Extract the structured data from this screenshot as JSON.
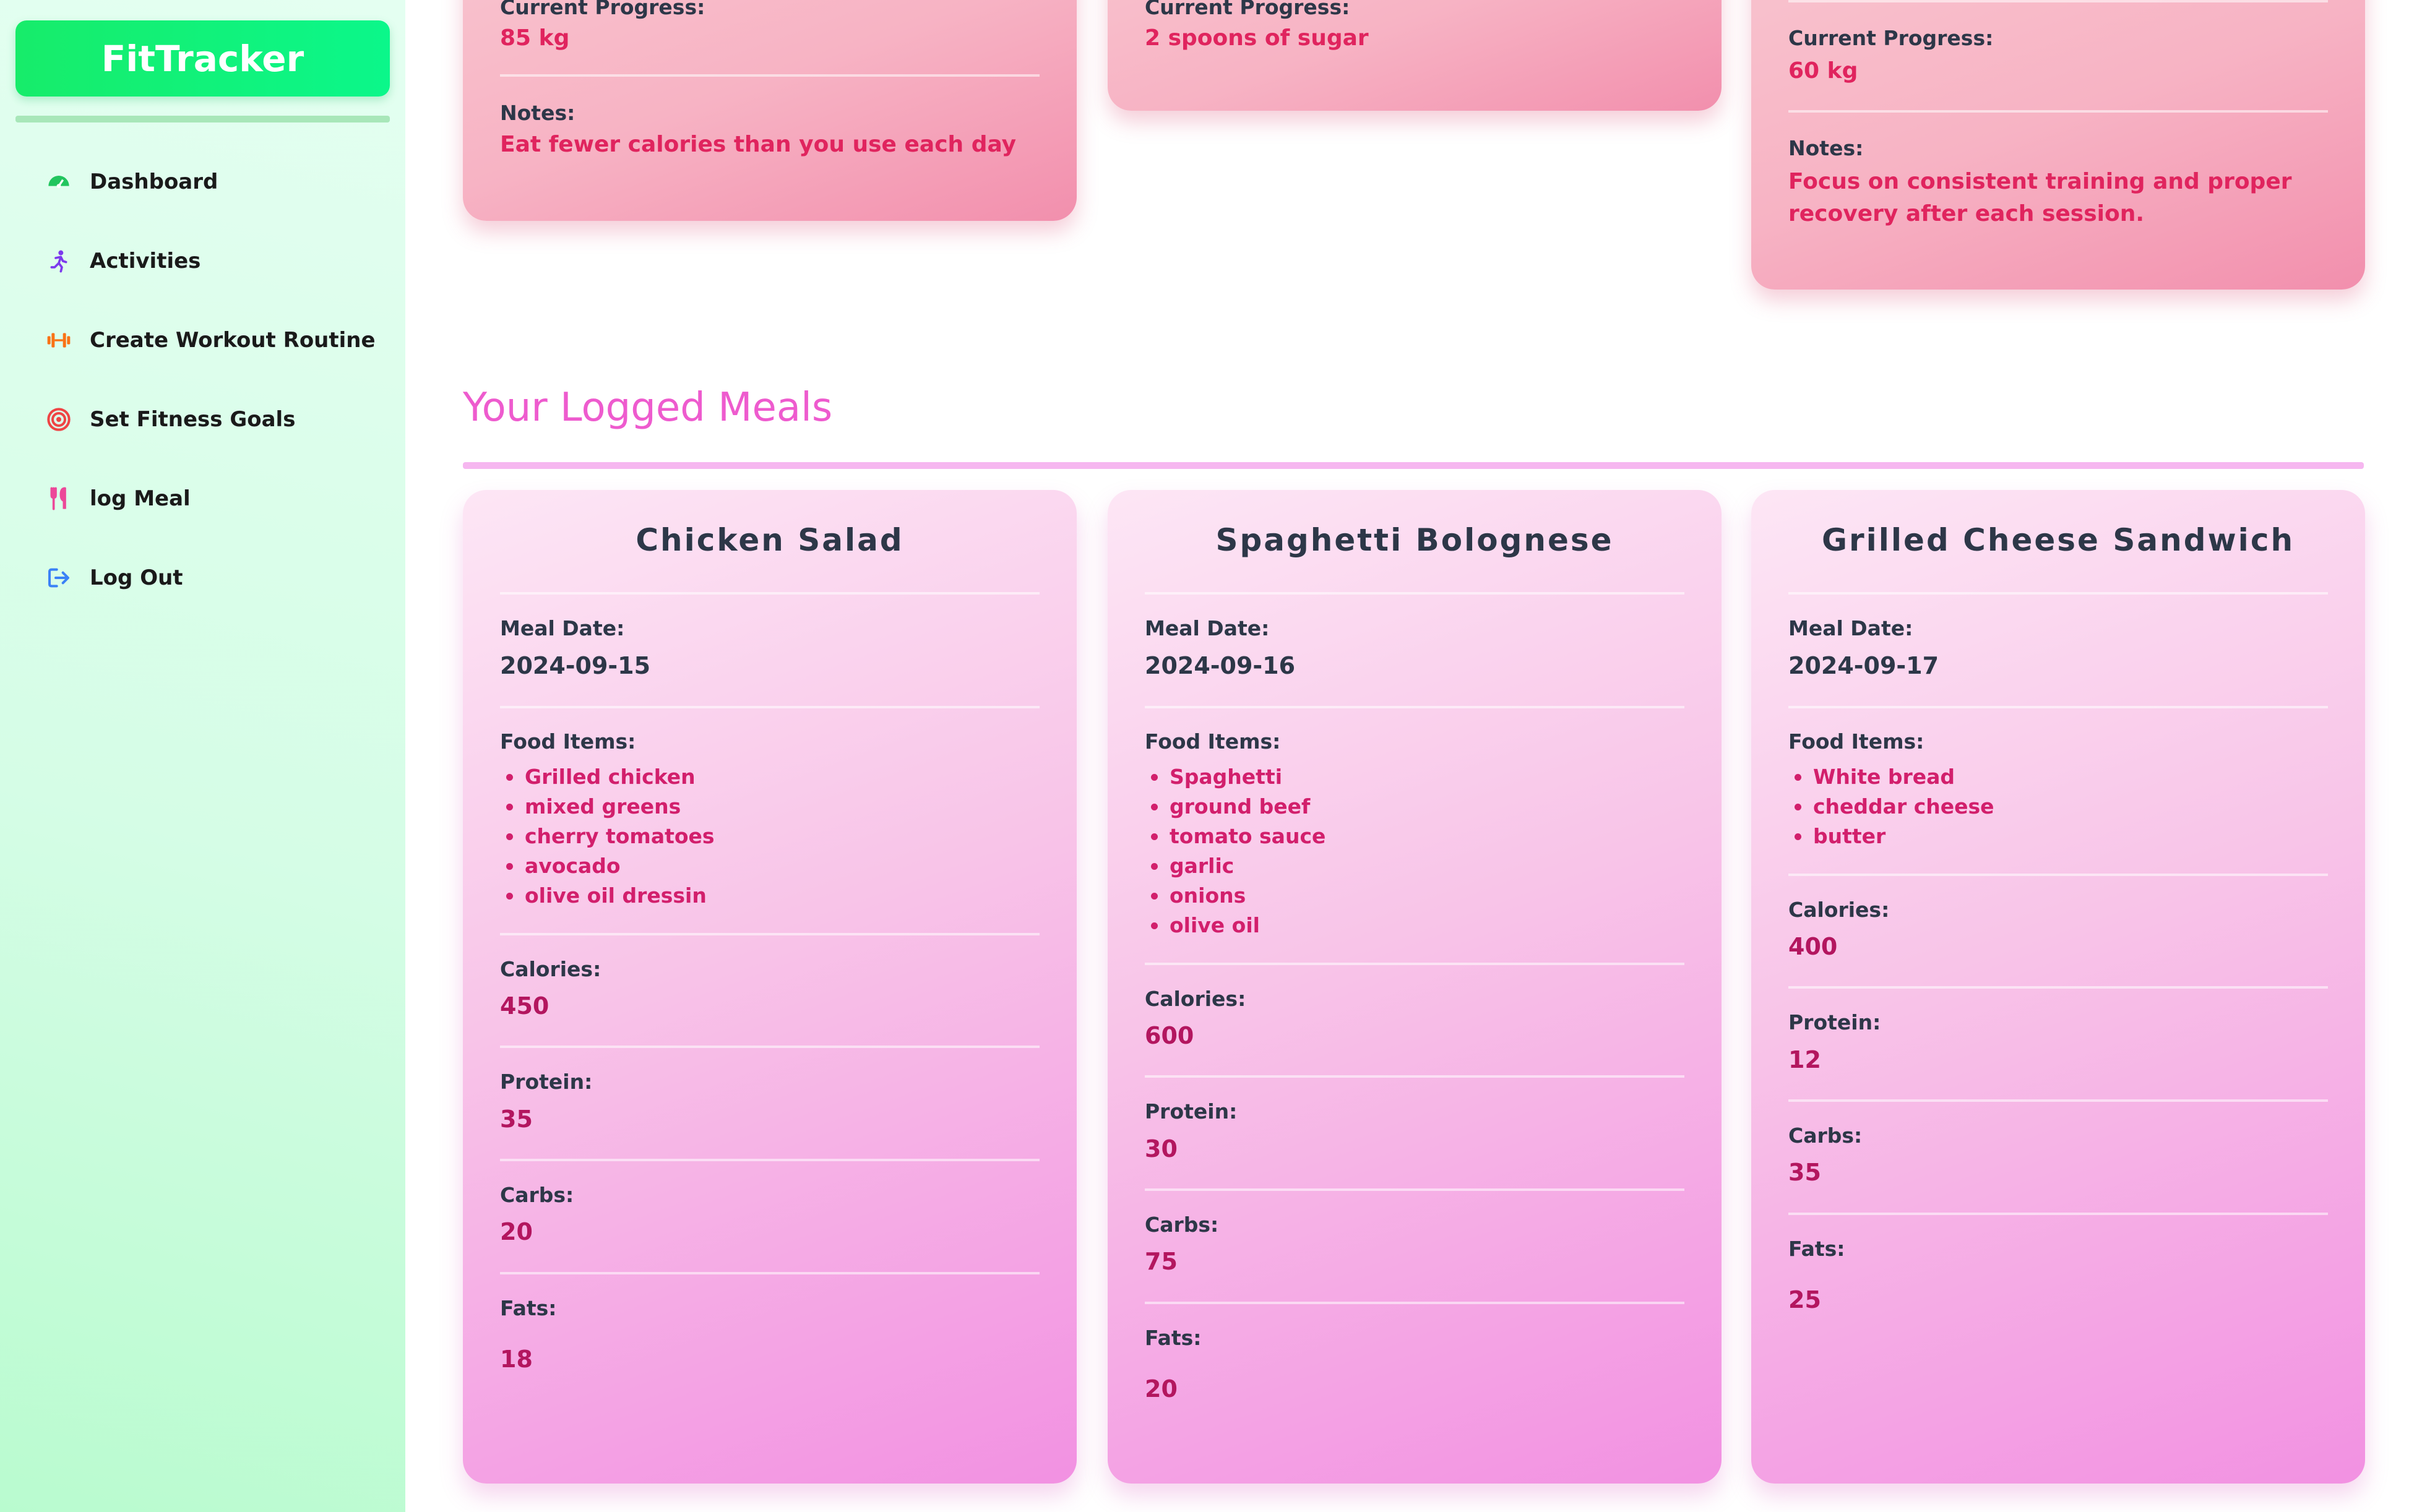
{
  "app": {
    "brand": "FitTracker"
  },
  "sidebar": {
    "items": [
      {
        "label": "Dashboard",
        "icon": "gauge-icon",
        "color": "#22c55e"
      },
      {
        "label": "Activities",
        "icon": "running-person-icon",
        "color": "#7c3aed"
      },
      {
        "label": "Create Workout Routine",
        "icon": "dumbbell-icon",
        "color": "#f97316"
      },
      {
        "label": "Set Fitness Goals",
        "icon": "target-icon",
        "color": "#ef4444"
      },
      {
        "label": "log Meal",
        "icon": "utensils-icon",
        "color": "#ec4899"
      },
      {
        "label": "Log Out",
        "icon": "logout-icon",
        "color": "#3b82f6"
      }
    ]
  },
  "goals": [
    {
      "progress_label": "Current Progress:",
      "progress_value": "85 kg",
      "notes_label": "Notes:",
      "notes_value": "Eat fewer calories than you use each day"
    },
    {
      "progress_label": "Current Progress:",
      "progress_value": "2 spoons of sugar"
    },
    {
      "progress_label": "Current Progress:",
      "progress_value": "60 kg",
      "notes_label": "Notes:",
      "notes_value": "Focus on consistent training and proper recovery after each session."
    }
  ],
  "meals_section": {
    "title": "Your Logged Meals"
  },
  "labels": {
    "meal_date": "Meal Date:",
    "food_items": "Food Items:",
    "calories": "Calories:",
    "protein": "Protein:",
    "carbs": "Carbs:",
    "fats": "Fats:"
  },
  "meals": [
    {
      "name": "Chicken Salad",
      "date": "2024-09-15",
      "food_items": [
        "Grilled chicken",
        "mixed greens",
        "cherry tomatoes",
        "avocado",
        "olive oil dressin"
      ],
      "calories": "450",
      "protein": "35",
      "carbs": "20",
      "fats": "18"
    },
    {
      "name": "Spaghetti Bolognese",
      "date": "2024-09-16",
      "food_items": [
        "Spaghetti",
        "ground beef",
        "tomato sauce",
        "garlic",
        "onions",
        "olive oil"
      ],
      "calories": "600",
      "protein": "30",
      "carbs": "75",
      "fats": "20"
    },
    {
      "name": "Grilled Cheese Sandwich",
      "date": "2024-09-17",
      "food_items": [
        "White bread",
        "cheddar cheese",
        "butter"
      ],
      "calories": "400",
      "protein": "12",
      "carbs": "35",
      "fats": "25"
    }
  ]
}
